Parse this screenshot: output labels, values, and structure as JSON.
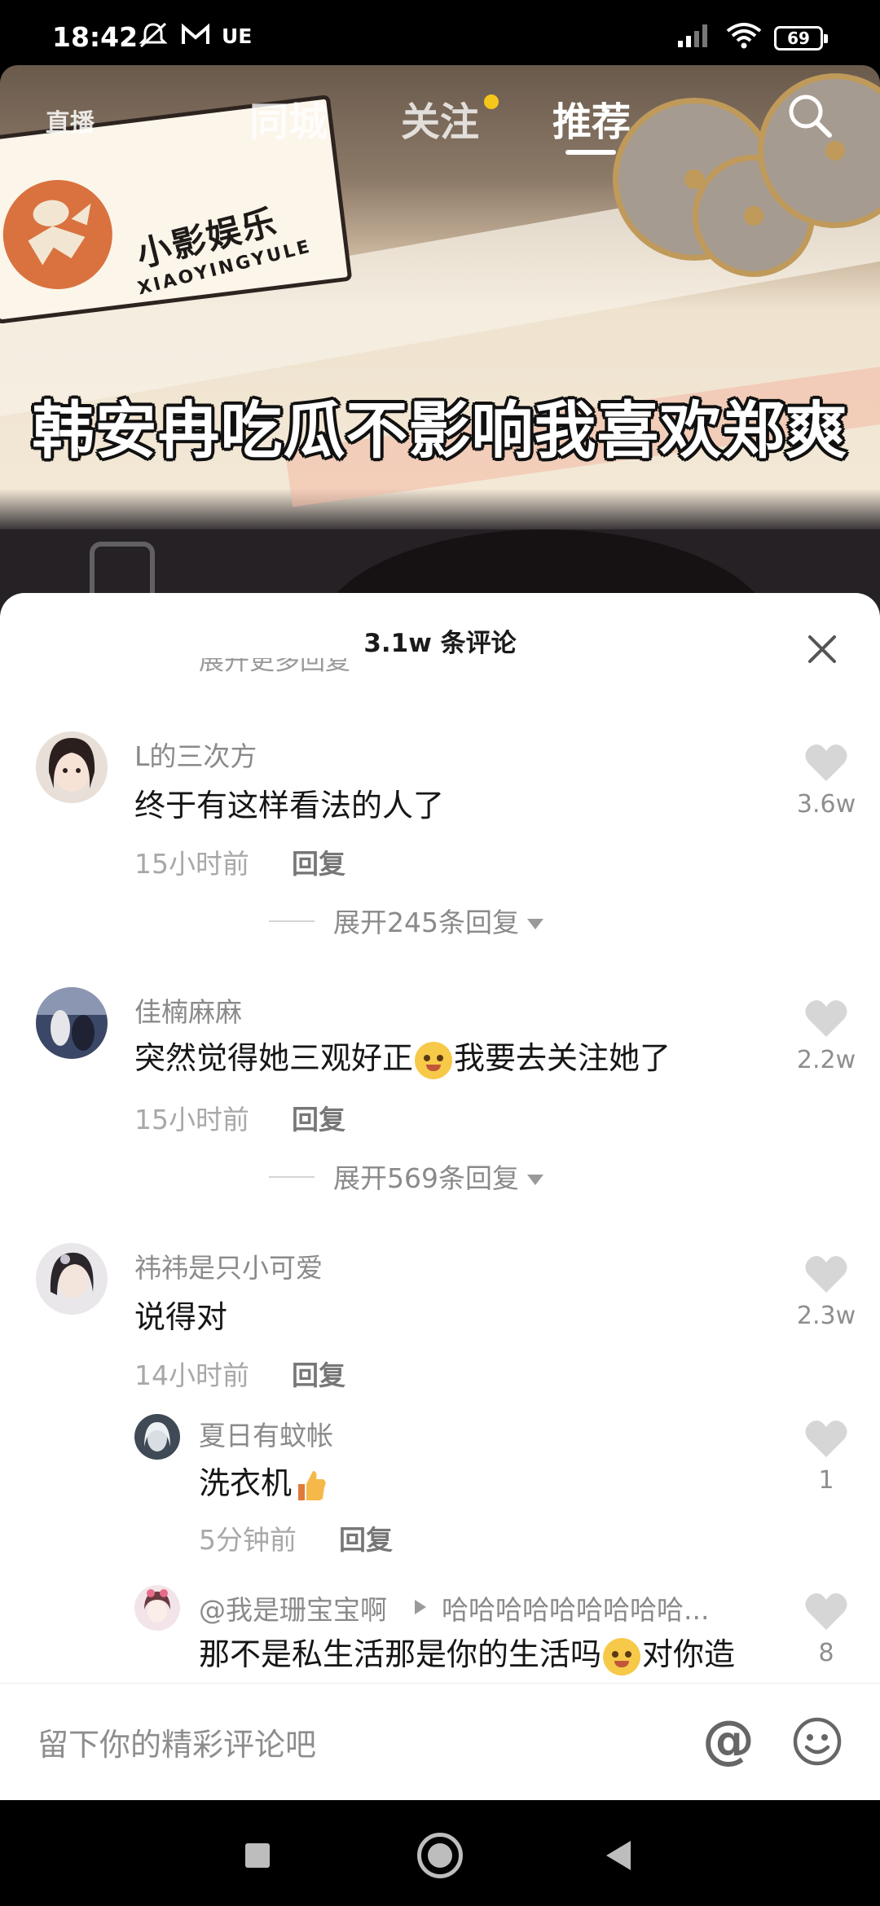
{
  "status_bar": {
    "time": "18:42",
    "carrier": "UE",
    "battery": "69",
    "icons": [
      "mute-icon",
      "mail-icon",
      "signal-icon",
      "wifi-icon",
      "battery-icon"
    ]
  },
  "video": {
    "tabs": {
      "live": "直播",
      "local": "同城",
      "follow": "关注",
      "recommend": "推荐",
      "active": "推荐"
    },
    "logo": {
      "name": "小影娱乐",
      "subtitle": "XIAOYINGYULE"
    },
    "caption": "韩安冉吃瓜不影响我喜欢郑爽",
    "colors": {
      "follow_dot": "#f6c71b"
    }
  },
  "comments_sheet": {
    "title": "3.1w 条评论",
    "partial_text": "展开更多回复",
    "comments": [
      {
        "user": "L的三次方",
        "text": "终于有这样看法的人了",
        "time": "15小时前",
        "reply_label": "回复",
        "likes": "3.6w",
        "expand": "展开245条回复"
      },
      {
        "user": "佳楠麻麻",
        "text_before": "突然觉得她三观好正",
        "text_after": "我要去关注她了",
        "time": "15小时前",
        "reply_label": "回复",
        "likes": "2.2w",
        "expand": "展开569条回复"
      },
      {
        "user": "祎祎是只小可爱",
        "text": "说得对",
        "time": "14小时前",
        "reply_label": "回复",
        "likes": "2.3w",
        "replies": [
          {
            "user": "夏日有蚊帐",
            "text": "洗衣机",
            "time": "5分钟前",
            "reply_label": "回复",
            "likes": "1"
          },
          {
            "user": "@我是珊宝宝啊",
            "reply_to": "哈哈哈哈哈哈哈哈哈...",
            "text_before": "那不是私生活那是你的生活吗",
            "text_after": "对你造",
            "likes": "8"
          }
        ]
      }
    ]
  },
  "input_bar": {
    "placeholder": "留下你的精彩评论吧",
    "at_label": "@"
  }
}
